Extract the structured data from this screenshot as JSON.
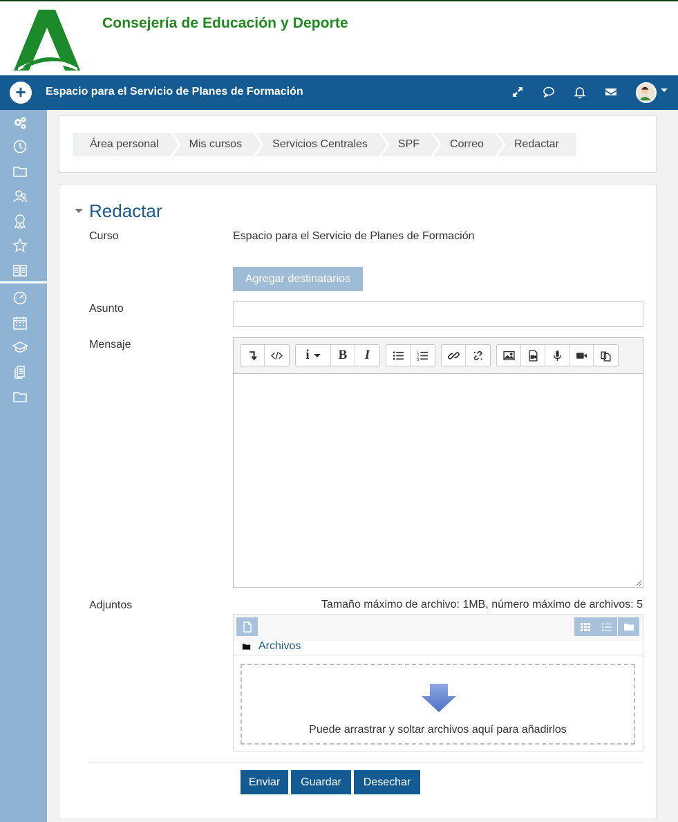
{
  "header": {
    "org_name": "Consejería de Educación y Deporte",
    "brand_color": "#1f8a1f"
  },
  "navbar": {
    "title": "Espacio para el Servicio de Planes de Formación",
    "color": "#145b94",
    "icons": [
      "expand-icon",
      "chat-icon",
      "bell-icon",
      "envelope-icon",
      "avatar",
      "chevron-down-icon"
    ]
  },
  "sidebar": {
    "icons": [
      "gears-icon",
      "clock-icon",
      "folder-icon",
      "users-icon",
      "badge-icon",
      "star-icon",
      "book-icon",
      "dashboard-icon",
      "calendar-icon",
      "graduation-cap-icon",
      "files-icon",
      "folder-icon"
    ]
  },
  "breadcrumb": [
    "Área personal",
    "Mis cursos",
    "Servicios Centrales",
    "SPF",
    "Correo",
    "Redactar"
  ],
  "form": {
    "title": "Redactar",
    "course_label": "Curso",
    "course_value": "Espacio para el Servicio de Planes de Formación",
    "add_recipients": "Agregar destinatarios",
    "subject_label": "Asunto",
    "subject_value": "",
    "message_label": "Mensaje",
    "attachments_label": "Adjuntos",
    "file_limits": "Tamaño máximo de archivo: 1MB, número máximo de archivos: 5",
    "folder_path": "Archivos",
    "drop_text": "Puede arrastrar y soltar archivos aquí para añadirlos",
    "buttons": {
      "send": "Enviar",
      "save": "Guardar",
      "discard": "Desechar"
    }
  },
  "editor_toolbar": {
    "groups": [
      [
        "collapse-icon",
        "html-icon"
      ],
      [
        "info-style-icon",
        "bold-icon",
        "italic-icon"
      ],
      [
        "unordered-list-icon",
        "ordered-list-icon"
      ],
      [
        "link-icon",
        "unlink-icon"
      ],
      [
        "image-icon",
        "media-icon",
        "record-audio-icon",
        "record-video-icon",
        "manage-files-icon"
      ]
    ],
    "bold_glyph": "B",
    "italic_glyph": "I",
    "info_glyph": "i"
  }
}
